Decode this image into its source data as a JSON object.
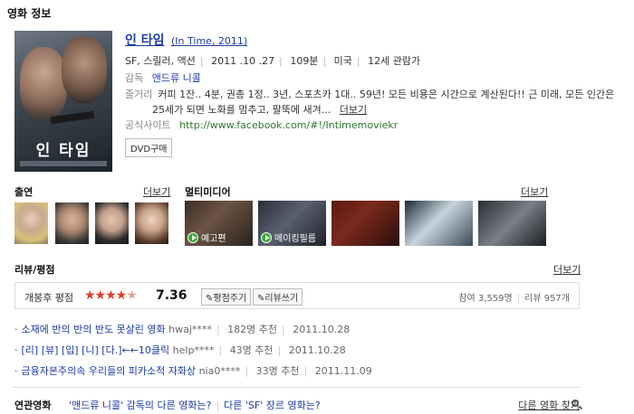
{
  "header": {
    "title": "영화 정보"
  },
  "movie": {
    "title": "인 타임",
    "original": "(In Time, 2011)",
    "genres": "SF, 스릴러, 액션",
    "release": "2011 .10 .27",
    "runtime": "109분",
    "country": "미국",
    "rating": "12세 관람가",
    "director_label": "감독",
    "director": "앤드류 니콜",
    "plot_label": "줄거리",
    "plot": "커피 1잔.. 4분, 권총 1정.. 3년, 스포츠카 1대.. 59년! 모든 비용은 시간으로 계산된다!! 근 미래, 모든 인간은 25세가 되면 노화를 멈추고, 팔뚝에 새겨...",
    "plot_more": "더보기",
    "site_label": "공식사이트",
    "site_url": "http://www.facebook.com/#!/Intimemoviekr",
    "dvd_button": "DVD구매",
    "poster_title": "인 타임"
  },
  "cast": {
    "title": "출연",
    "more": "더보기"
  },
  "multimedia": {
    "title": "멀티미디어",
    "more": "더보기",
    "items": [
      {
        "caption": "예고편"
      },
      {
        "caption": "메이킹필름"
      }
    ]
  },
  "reviews": {
    "title": "리뷰/평점",
    "more": "더보기",
    "rating_label": "개봉후 평점",
    "score": "7.36",
    "rate_button": "✎평점주기",
    "write_button": "✎리뷰쓰기",
    "participants": "참여 3,559명",
    "review_count": "리뷰 957개",
    "items": [
      {
        "title": "소재에 반의 반의 반도 못살린 영화",
        "author": "hwaj****",
        "recommend": "182명 추천",
        "date": "2011.10.28"
      },
      {
        "title": "[리] [뷰] [입] [니] [다.]←←10클릭",
        "author": "help****",
        "recommend": "43명 추천",
        "date": "2011.10.28"
      },
      {
        "title": "금융자본주의속 우리들의 피카소적 자화상",
        "author": "nia0****",
        "recommend": "33명 추천",
        "date": "2011.11.09"
      }
    ]
  },
  "related": {
    "label": "연관영화",
    "link1": "'앤드류 니콜' 감독의 다른 영화는?",
    "link2": "다른 'SF' 장르 영화는?",
    "search": "다른 영화 찾기"
  },
  "colors": {
    "link": "#1a3ba8",
    "site": "#2d7a2d",
    "star": "#e23a2b"
  }
}
